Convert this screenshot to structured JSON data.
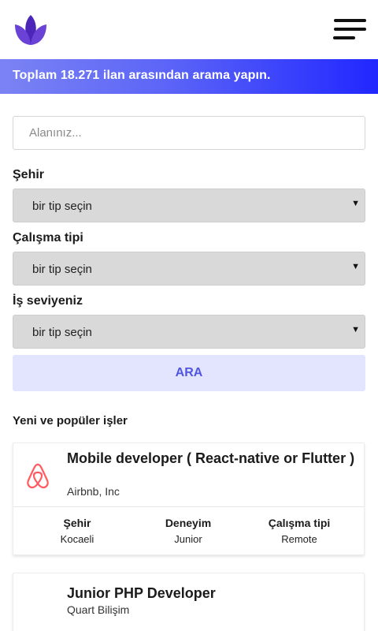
{
  "header": {
    "logo": "lotus-logo",
    "menu_icon": "hamburger-icon"
  },
  "banner": {
    "text": "Toplam 18.271 ilan arasından arama yapın."
  },
  "search": {
    "placeholder": "Alanınız..."
  },
  "filters": {
    "city": {
      "label": "Şehir",
      "value": "bir tip seçin"
    },
    "work_type": {
      "label": "Çalışma tipi",
      "value": "bir tip seçin"
    },
    "level": {
      "label": "İş seviyeniz",
      "value": "bir tip seçin"
    },
    "arrow": "▼"
  },
  "search_button": {
    "label": "ARA"
  },
  "section": {
    "title": "Yeni ve popüler işler"
  },
  "jobs": [
    {
      "title": "Mobile developer ( React-native or Flutter )",
      "company": "Airbnb, Inc",
      "logo_icon": "airbnb-icon",
      "meta": [
        {
          "label": "Şehir",
          "value": "Kocaeli"
        },
        {
          "label": "Deneyim",
          "value": "Junior"
        },
        {
          "label": "Çalışma tipi",
          "value": "Remote"
        }
      ]
    },
    {
      "title": "Junior PHP Developer",
      "company": "Quart Bilişim"
    }
  ],
  "colors": {
    "brand_purple": "#5b37c9",
    "banner_start": "#7b83f4",
    "banner_end": "#2127ff",
    "button_bg": "#e3e4fd",
    "button_text": "#5156e0",
    "airbnb": "#ff5a5f"
  }
}
